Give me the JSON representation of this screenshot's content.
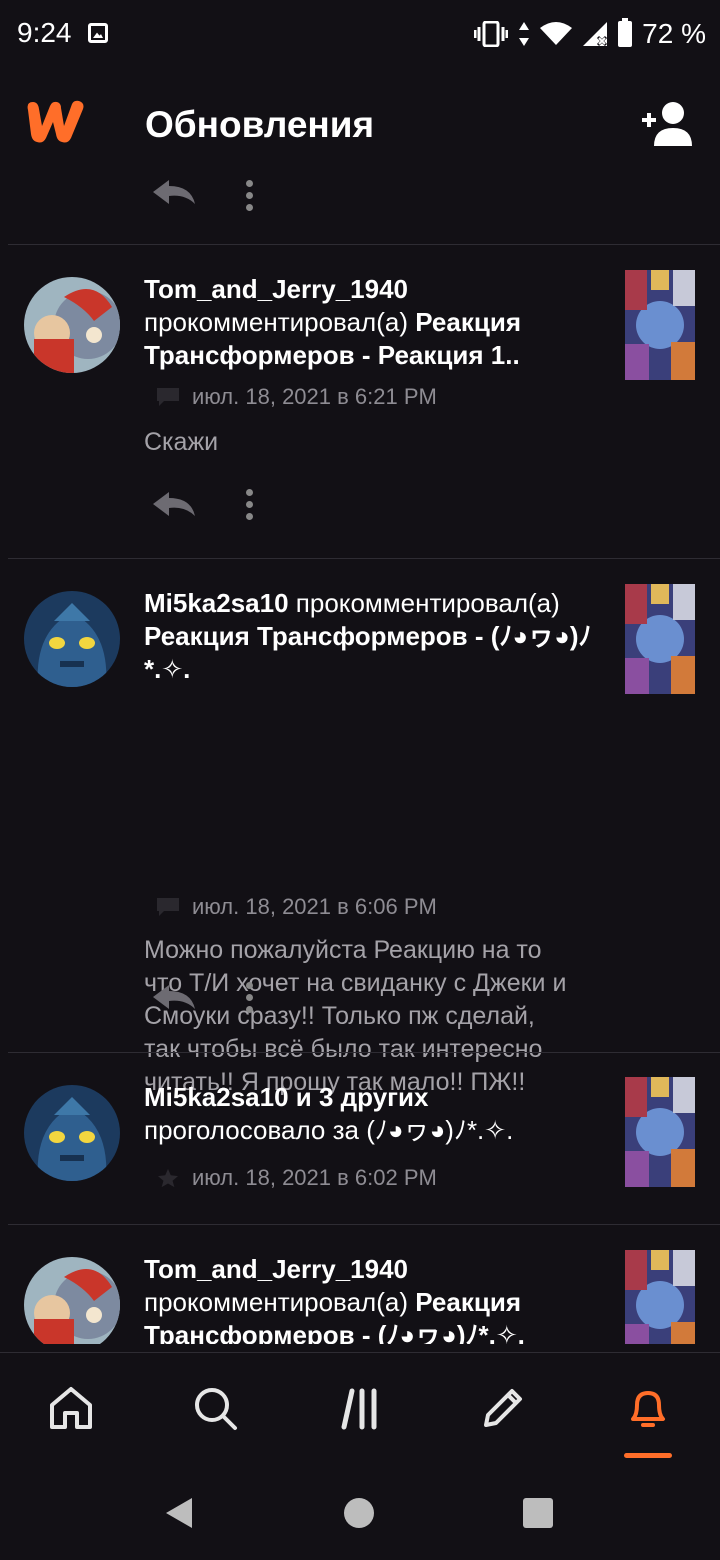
{
  "status_bar": {
    "time": "9:24",
    "battery": "72 %",
    "icons": [
      "image-icon",
      "vibrate-icon",
      "data-arrows-icon",
      "wifi-icon",
      "signal-icon",
      "battery-icon"
    ]
  },
  "header": {
    "title": "Обновления",
    "logo_icon": "wattpad-logo",
    "action_icon": "add-user-icon"
  },
  "colors": {
    "accent": "#ff6e29",
    "background": "#121015",
    "divider": "#2e2c33",
    "muted_text": "#8e8c93",
    "body_text": "#a4a2a8"
  },
  "feed": {
    "items": [
      {
        "user": "Tom_and_Jerry_1940",
        "action": "прокомментировал(а)",
        "story": "Реакция Трансформеров - Реакция 1..",
        "meta_icon": "comment-icon",
        "timestamp": "июл. 18, 2021 в 6:21 PM",
        "comment": "Скажи"
      },
      {
        "user": "Mi5ka2sa10",
        "action": "прокомментировал(а)",
        "story": "Реакция Трансформеров - (ﾉ◕ヮ◕)ﾉ*.✧.",
        "meta_icon": "comment-icon",
        "timestamp": "июл. 18, 2021 в 6:06 PM",
        "comment": "Можно пожалуйста Реакцию на то что Т/И хочет на свиданку с Джеки и Смоуки сразу!! Только пж сделай, так чтобы всё было так интересно читать!! Я прошу так мало!! ПЖ!!"
      },
      {
        "user": "Mi5ka2sa10 и 3 других",
        "action": "проголосовало за",
        "story": "(ﾉ◕ヮ◕)ﾉ*.✧.",
        "meta_icon": "star-icon",
        "timestamp": "июл. 18, 2021 в 6:02 PM"
      },
      {
        "user": "Tom_and_Jerry_1940",
        "action": "прокомментировал(а)",
        "story": "Реакция Трансформеров - (ﾉ◕ヮ◕)ﾉ*.✧."
      }
    ]
  },
  "bottom_nav": {
    "items": [
      "home-icon",
      "search-icon",
      "library-icon",
      "write-icon",
      "notifications-icon"
    ],
    "active": "notifications-icon"
  },
  "system_nav": {
    "items": [
      "back-icon",
      "home-circle-icon",
      "recents-icon"
    ]
  }
}
